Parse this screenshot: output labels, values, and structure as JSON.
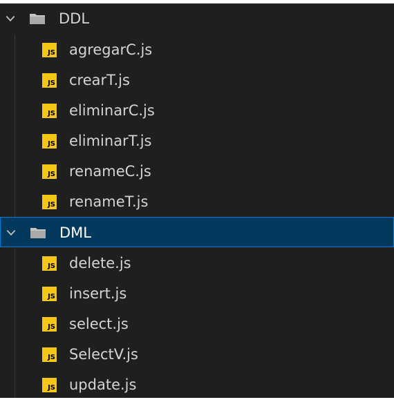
{
  "colors": {
    "background": "#1f1f1f",
    "text": "#d4d4d4",
    "selected_background": "#04395e",
    "selected_border": "#007fd4",
    "js_icon": "#f5c518",
    "folder_icon": "#c5c5c5"
  },
  "tree": {
    "folders": [
      {
        "name": "DDL",
        "expanded": true,
        "selected": false,
        "icon": "folder-icon",
        "files": [
          {
            "name": "agregarC.js",
            "icon": "js-file-icon",
            "icon_text": "JS"
          },
          {
            "name": "crearT.js",
            "icon": "js-file-icon",
            "icon_text": "JS"
          },
          {
            "name": "eliminarC.js",
            "icon": "js-file-icon",
            "icon_text": "JS"
          },
          {
            "name": "eliminarT.js",
            "icon": "js-file-icon",
            "icon_text": "JS"
          },
          {
            "name": "renameC.js",
            "icon": "js-file-icon",
            "icon_text": "JS"
          },
          {
            "name": "renameT.js",
            "icon": "js-file-icon",
            "icon_text": "JS"
          }
        ]
      },
      {
        "name": "DML",
        "expanded": true,
        "selected": true,
        "icon": "folder-icon",
        "files": [
          {
            "name": "delete.js",
            "icon": "js-file-icon",
            "icon_text": "JS"
          },
          {
            "name": "insert.js",
            "icon": "js-file-icon",
            "icon_text": "JS"
          },
          {
            "name": "select.js",
            "icon": "js-file-icon",
            "icon_text": "JS"
          },
          {
            "name": "SelectV.js",
            "icon": "js-file-icon",
            "icon_text": "JS"
          },
          {
            "name": "update.js",
            "icon": "js-file-icon",
            "icon_text": "JS"
          }
        ]
      }
    ]
  }
}
